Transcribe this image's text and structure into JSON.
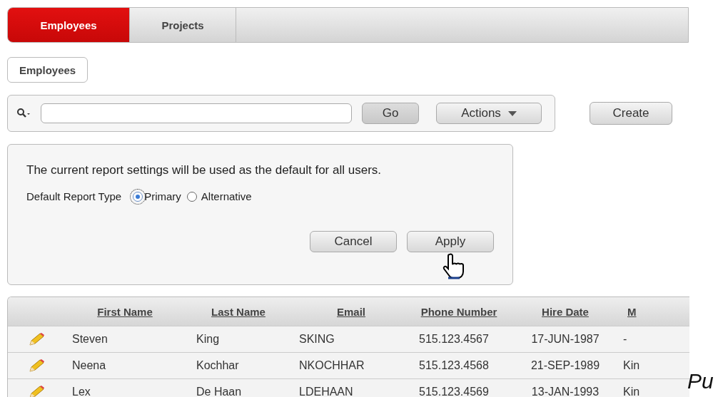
{
  "tabs": [
    {
      "label": "Employees",
      "selected": true
    },
    {
      "label": "Projects",
      "selected": false
    }
  ],
  "breadcrumb": "Employees",
  "search": {
    "go": "Go",
    "actions": "Actions",
    "create": "Create"
  },
  "dialog": {
    "message": "The current report settings will be used as the default for all users.",
    "field_label": "Default Report Type",
    "options": [
      {
        "label": "Primary",
        "selected": true
      },
      {
        "label": "Alternative",
        "selected": false
      }
    ],
    "buttons": [
      "Cancel",
      "Apply"
    ]
  },
  "table": {
    "columns": [
      "First Name",
      "Last Name",
      "Email",
      "Phone Number",
      "Hire Date",
      "M"
    ],
    "rows": [
      [
        "Steven",
        "King",
        "SKING",
        "515.123.4567",
        "17-JUN-1987",
        "-"
      ],
      [
        "Neena",
        "Kochhar",
        "NKOCHHAR",
        "515.123.4568",
        "21-SEP-1989",
        "Kin"
      ],
      [
        "Lex",
        "De Haan",
        "LDEHAAN",
        "515.123.4569",
        "13-JAN-1993",
        "Kin"
      ]
    ]
  },
  "trailing_text": "Pu"
}
